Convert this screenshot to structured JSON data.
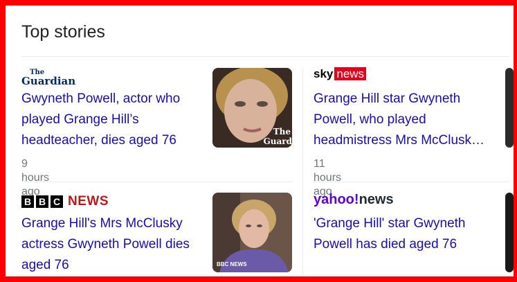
{
  "section_title": "Top stories",
  "stories": [
    {
      "source": "The Guardian",
      "logo_line1": "The",
      "logo_line2": "Guardian",
      "headline": "Gwyneth Powell, actor who played Grange Hill’s headteacher, dies aged 76",
      "time": "9 hours ago",
      "thumb_watermark_1": "The",
      "thumb_watermark_2": "Guard"
    },
    {
      "source": "Sky News",
      "logo_sky": "sky",
      "logo_news": "news",
      "headline": "Grange Hill star Gwyneth Powell, who played headmistress Mrs McClusk…",
      "time": "11 hours ago"
    },
    {
      "source": "BBC News",
      "logo_b1": "B",
      "logo_b2": "B",
      "logo_c": "C",
      "logo_news": "NEWS",
      "headline": "Grange Hill's Mrs McClusky actress Gwyneth Powell dies aged 76",
      "thumb_watermark": "BBC NEWS"
    },
    {
      "source": "Yahoo News",
      "logo_yahoo": "yahoo!",
      "logo_news": "news",
      "headline": "'Grange Hill' star Gwyneth Powell has died aged 76"
    }
  ],
  "colors": {
    "link": "#1a0dab",
    "meta": "#70757a",
    "frame": "#ff0000"
  }
}
